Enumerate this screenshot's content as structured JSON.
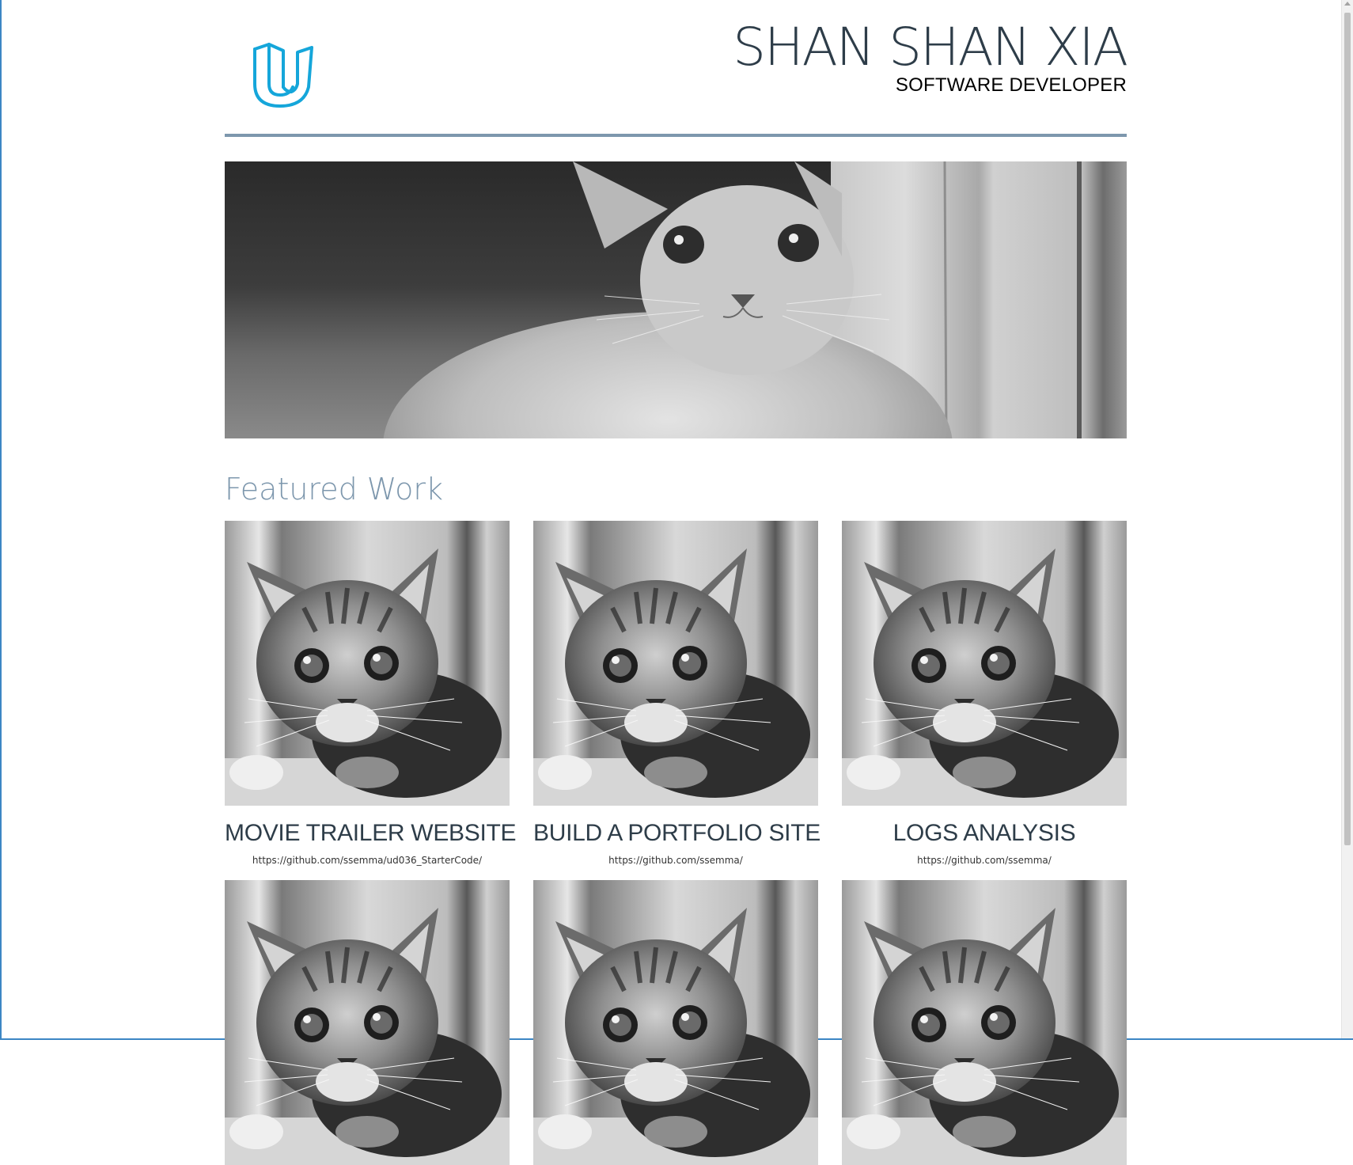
{
  "header": {
    "name": "SHAN SHAN XIA",
    "role": "SOFTWARE DEVELOPER",
    "logo_icon": "udacity-logo-icon",
    "logo_color": "#15a6da"
  },
  "hero": {
    "image": "kitten-hero-image"
  },
  "featured": {
    "title": "Featured Work",
    "title_color": "#7d97ad",
    "items": [
      {
        "title": "MOVIE TRAILER WEBSITE",
        "link": "https://github.com/ssemma/ud036_StarterCode/"
      },
      {
        "title": "BUILD A PORTFOLIO SITE",
        "link": "https://github.com/ssemma/"
      },
      {
        "title": "LOGS ANALYSIS",
        "link": "https://github.com/ssemma/"
      },
      {
        "title": "",
        "link": ""
      },
      {
        "title": "",
        "link": ""
      },
      {
        "title": "",
        "link": ""
      }
    ]
  },
  "colors": {
    "rule": "#7d97ad",
    "text": "#2e3d49"
  }
}
